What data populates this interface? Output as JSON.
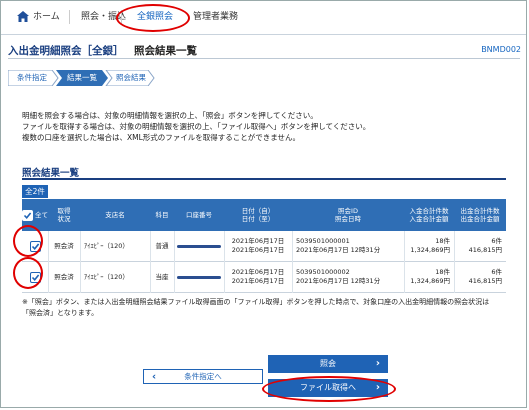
{
  "nav": {
    "home": "ホーム",
    "items": [
      "照会・振込",
      "全銀照会",
      "管理者業務"
    ]
  },
  "page": {
    "title": "入出金明細照会［全銀］",
    "subtitle": "照会結果一覧",
    "screen_id": "BNMD002"
  },
  "steps": [
    "条件指定",
    "結果一覧",
    "照会結果"
  ],
  "instructions": [
    "明細を照会する場合は、対象の明細情報を選択の上、「照会」ボタンを押してください。",
    "ファイルを取得する場合は、対象の明細情報を選択の上、「ファイル取得へ」ボタンを押してください。",
    "複数の口座を選択した場合は、XML形式のファイルを取得することができません。"
  ],
  "results": {
    "section_title": "照会結果一覧",
    "count_label": "全2件",
    "headers": {
      "select_all": "全て",
      "status": "取得\n状況",
      "branch": "支店名",
      "type": "科目",
      "account": "口座番号",
      "date": "日付（自）\n日付（至）",
      "inquiry": "照会ID\n照会日時",
      "deposit": "入金合計件数\n入金合計金額",
      "withdraw": "出金合計件数\n出金合計金額"
    },
    "rows": [
      {
        "status": "照会済",
        "branch": "ｱｲｴﾋﾟｰ（120）",
        "type": "普通",
        "date_from": "2021年06月17日",
        "date_to": "2021年06月17日",
        "inquiry_id": "5039501000001",
        "inquiry_time": "2021年06月17日 12時31分",
        "dep_count": "18件",
        "dep_amount": "1,324,869円",
        "wd_count": "6件",
        "wd_amount": "416,815円",
        "checked": true
      },
      {
        "status": "照会済",
        "branch": "ｱｲｴﾋﾟｰ（120）",
        "type": "当座",
        "date_from": "2021年06月17日",
        "date_to": "2021年06月17日",
        "inquiry_id": "5039501000002",
        "inquiry_time": "2021年06月17日 12時31分",
        "dep_count": "18件",
        "dep_amount": "1,324,869円",
        "wd_count": "6件",
        "wd_amount": "416,815円",
        "checked": true
      }
    ],
    "notes": [
      "※「照会」ボタン、または入出金明細照会結果ファイル取得画面の「ファイル取得」ボタンを押した時点で、対象口座の入出金明細情報の照会状況は",
      "「照会済」となります。"
    ]
  },
  "buttons": {
    "inquire": "照会",
    "back": "条件指定へ",
    "file": "ファイル取得へ"
  },
  "colors": {
    "accent": "#1f63b5",
    "header_bg": "#2f6eb5",
    "highlight": "#e00000"
  }
}
